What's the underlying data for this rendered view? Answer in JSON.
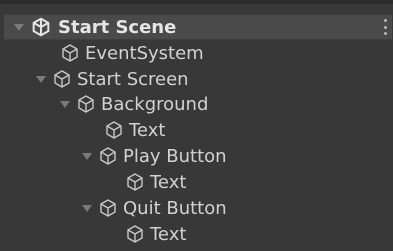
{
  "hierarchy": {
    "scene_title": "Start Scene",
    "items": [
      {
        "label": "EventSystem",
        "icon": "cube-icon",
        "expandable": false
      },
      {
        "label": "Start Screen",
        "icon": "cube-icon",
        "expandable": true
      },
      {
        "label": "Background",
        "icon": "cube-icon",
        "expandable": true
      },
      {
        "label": "Text",
        "icon": "cube-icon",
        "expandable": false
      },
      {
        "label": "Play Button",
        "icon": "cube-icon",
        "expandable": true
      },
      {
        "label": "Text",
        "icon": "cube-icon",
        "expandable": false
      },
      {
        "label": "Quit Button",
        "icon": "cube-icon",
        "expandable": true
      },
      {
        "label": "Text",
        "icon": "cube-icon",
        "expandable": false
      }
    ]
  },
  "colors": {
    "background": "#383838",
    "header": "#4a4a4a",
    "text": "#d2d2d2"
  }
}
